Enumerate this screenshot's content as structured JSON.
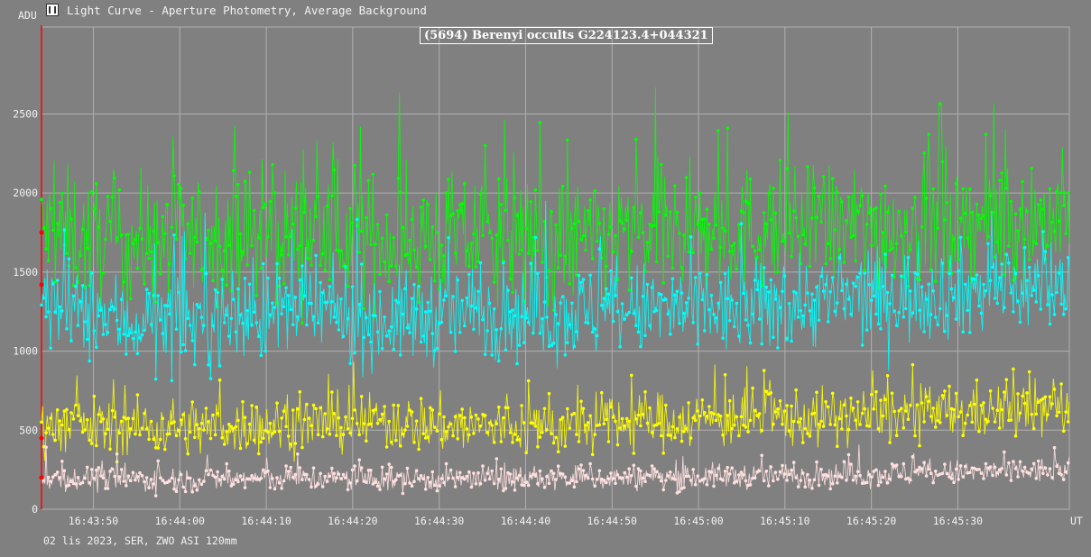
{
  "window": {
    "title": "Light Curve - Aperture Photometry, Average Background",
    "icon": "app-icon"
  },
  "footer": {
    "info": "02 lis 2023, SER, ZWO ASI 120mm"
  },
  "colors": {
    "background": "#808080",
    "grid": "#b0b0b0",
    "green": "#00ff00",
    "cyan": "#00ffff",
    "yellow": "#ffff00",
    "pink": "#ffe0e0",
    "marker": "#ff0000"
  },
  "chart_data": {
    "type": "scatter",
    "title": "(5694) Berenyi occults G224123.4+044321",
    "ylabel": "ADU",
    "xlabel": "UT",
    "ylim": [
      0,
      3050
    ],
    "xlim": [
      0,
      118.9
    ],
    "grid": true,
    "yticks": [
      0,
      500,
      1000,
      1500,
      2000,
      2500
    ],
    "xticks": [
      {
        "x": 6,
        "label": "16:43:50"
      },
      {
        "x": 16,
        "label": "16:44:00"
      },
      {
        "x": 26,
        "label": "16:44:10"
      },
      {
        "x": 36,
        "label": "16:44:20"
      },
      {
        "x": 46,
        "label": "16:44:30"
      },
      {
        "x": 56,
        "label": "16:44:40"
      },
      {
        "x": 66,
        "label": "16:44:50"
      },
      {
        "x": 76,
        "label": "16:45:00"
      },
      {
        "x": 86,
        "label": "16:45:10"
      },
      {
        "x": 96,
        "label": "16:45:20"
      },
      {
        "x": 106,
        "label": "16:45:30"
      }
    ],
    "x_unit": "seconds after 16:43:44 UT",
    "series": [
      {
        "color": "#00ff00",
        "mean_anchors": [
          [
            0,
            1760
          ],
          [
            10,
            1680
          ],
          [
            20,
            1720
          ],
          [
            30,
            1760
          ],
          [
            40,
            1700
          ],
          [
            50,
            1720
          ],
          [
            60,
            1680
          ],
          [
            70,
            1740
          ],
          [
            80,
            1760
          ],
          [
            90,
            1780
          ],
          [
            100,
            1800
          ],
          [
            110,
            1820
          ],
          [
            118.9,
            1840
          ]
        ],
        "scatter": 200,
        "spikes_max": 2640
      },
      {
        "color": "#00ffff",
        "mean_anchors": [
          [
            0,
            1300
          ],
          [
            10,
            1180
          ],
          [
            20,
            1200
          ],
          [
            30,
            1260
          ],
          [
            40,
            1200
          ],
          [
            50,
            1250
          ],
          [
            60,
            1240
          ],
          [
            70,
            1260
          ],
          [
            80,
            1250
          ],
          [
            90,
            1320
          ],
          [
            100,
            1350
          ],
          [
            110,
            1400
          ],
          [
            118.9,
            1420
          ]
        ],
        "scatter": 150
      },
      {
        "color": "#ffff00",
        "mean_anchors": [
          [
            0,
            540
          ],
          [
            10,
            520
          ],
          [
            20,
            520
          ],
          [
            30,
            540
          ],
          [
            40,
            550
          ],
          [
            50,
            520
          ],
          [
            60,
            520
          ],
          [
            70,
            560
          ],
          [
            80,
            570
          ],
          [
            90,
            580
          ],
          [
            100,
            600
          ],
          [
            110,
            620
          ],
          [
            118.9,
            640
          ]
        ],
        "scatter": 90
      },
      {
        "color": "#ffe0e0",
        "mean_anchors": [
          [
            0,
            200
          ],
          [
            10,
            190
          ],
          [
            20,
            190
          ],
          [
            30,
            195
          ],
          [
            40,
            190
          ],
          [
            50,
            190
          ],
          [
            60,
            195
          ],
          [
            70,
            200
          ],
          [
            80,
            210
          ],
          [
            90,
            215
          ],
          [
            100,
            225
          ],
          [
            110,
            235
          ],
          [
            118.9,
            245
          ]
        ],
        "scatter": 40
      }
    ],
    "markers": [
      {
        "x": 0,
        "y": 1750
      },
      {
        "x": 0,
        "y": 1420
      },
      {
        "x": 0,
        "y": 450
      },
      {
        "x": 0,
        "y": 200
      }
    ]
  }
}
